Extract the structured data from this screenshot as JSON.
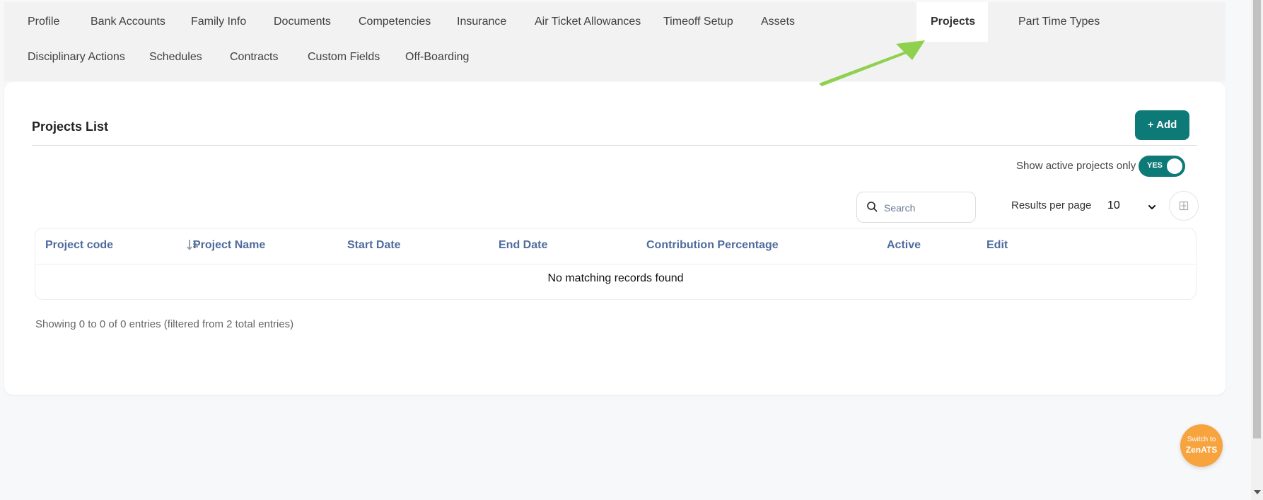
{
  "tabs": [
    {
      "label": "Profile"
    },
    {
      "label": "Bank Accounts"
    },
    {
      "label": "Family Info"
    },
    {
      "label": "Documents"
    },
    {
      "label": "Competencies"
    },
    {
      "label": "Insurance"
    },
    {
      "label": "Air Ticket Allowances"
    },
    {
      "label": "Timeoff Setup"
    },
    {
      "label": "Assets"
    },
    {
      "label": "Projects",
      "active": true
    },
    {
      "label": "Part Time Types"
    },
    {
      "label": "Disciplinary Actions"
    },
    {
      "label": "Schedules"
    },
    {
      "label": "Contracts"
    },
    {
      "label": "Custom Fields"
    },
    {
      "label": "Off-Boarding"
    }
  ],
  "card": {
    "title": "Projects List",
    "add_label": "+ Add",
    "toggle_label": "Show active projects only",
    "toggle_state": "YES"
  },
  "search": {
    "placeholder": "Search",
    "icon": "search-icon"
  },
  "results_per_page": {
    "label": "Results per page",
    "value": "10"
  },
  "table": {
    "columns": [
      "Project code",
      "Project Name",
      "Start Date",
      "End Date",
      "Contribution Percentage",
      "Active",
      "Edit"
    ],
    "empty_message": "No matching records found",
    "footer": "Showing 0 to 0 of 0 entries (filtered from 2 total entries)"
  },
  "switch_button": {
    "line1": "Switch to",
    "line2": "ZenATS"
  },
  "colors": {
    "accent": "#0d7a78",
    "header_text": "#4f6b9d",
    "switch_bg": "#f7a33e",
    "annotation_arrow": "#8fd14f"
  }
}
